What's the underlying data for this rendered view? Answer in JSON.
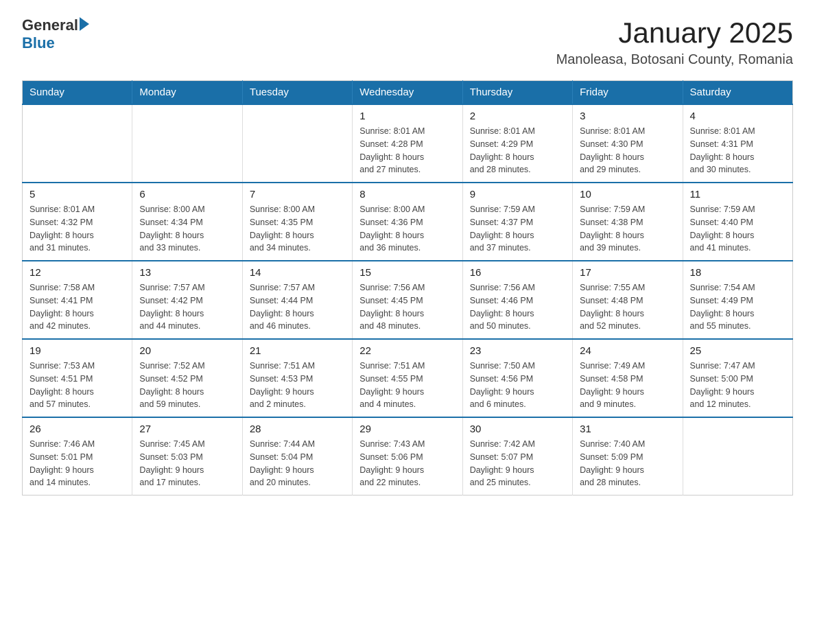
{
  "header": {
    "logo": {
      "text_general": "General",
      "text_blue": "Blue"
    },
    "month_year": "January 2025",
    "location": "Manoleasa, Botosani County, Romania"
  },
  "days_of_week": [
    "Sunday",
    "Monday",
    "Tuesday",
    "Wednesday",
    "Thursday",
    "Friday",
    "Saturday"
  ],
  "weeks": [
    [
      {
        "day": "",
        "info": ""
      },
      {
        "day": "",
        "info": ""
      },
      {
        "day": "",
        "info": ""
      },
      {
        "day": "1",
        "info": "Sunrise: 8:01 AM\nSunset: 4:28 PM\nDaylight: 8 hours\nand 27 minutes."
      },
      {
        "day": "2",
        "info": "Sunrise: 8:01 AM\nSunset: 4:29 PM\nDaylight: 8 hours\nand 28 minutes."
      },
      {
        "day": "3",
        "info": "Sunrise: 8:01 AM\nSunset: 4:30 PM\nDaylight: 8 hours\nand 29 minutes."
      },
      {
        "day": "4",
        "info": "Sunrise: 8:01 AM\nSunset: 4:31 PM\nDaylight: 8 hours\nand 30 minutes."
      }
    ],
    [
      {
        "day": "5",
        "info": "Sunrise: 8:01 AM\nSunset: 4:32 PM\nDaylight: 8 hours\nand 31 minutes."
      },
      {
        "day": "6",
        "info": "Sunrise: 8:00 AM\nSunset: 4:34 PM\nDaylight: 8 hours\nand 33 minutes."
      },
      {
        "day": "7",
        "info": "Sunrise: 8:00 AM\nSunset: 4:35 PM\nDaylight: 8 hours\nand 34 minutes."
      },
      {
        "day": "8",
        "info": "Sunrise: 8:00 AM\nSunset: 4:36 PM\nDaylight: 8 hours\nand 36 minutes."
      },
      {
        "day": "9",
        "info": "Sunrise: 7:59 AM\nSunset: 4:37 PM\nDaylight: 8 hours\nand 37 minutes."
      },
      {
        "day": "10",
        "info": "Sunrise: 7:59 AM\nSunset: 4:38 PM\nDaylight: 8 hours\nand 39 minutes."
      },
      {
        "day": "11",
        "info": "Sunrise: 7:59 AM\nSunset: 4:40 PM\nDaylight: 8 hours\nand 41 minutes."
      }
    ],
    [
      {
        "day": "12",
        "info": "Sunrise: 7:58 AM\nSunset: 4:41 PM\nDaylight: 8 hours\nand 42 minutes."
      },
      {
        "day": "13",
        "info": "Sunrise: 7:57 AM\nSunset: 4:42 PM\nDaylight: 8 hours\nand 44 minutes."
      },
      {
        "day": "14",
        "info": "Sunrise: 7:57 AM\nSunset: 4:44 PM\nDaylight: 8 hours\nand 46 minutes."
      },
      {
        "day": "15",
        "info": "Sunrise: 7:56 AM\nSunset: 4:45 PM\nDaylight: 8 hours\nand 48 minutes."
      },
      {
        "day": "16",
        "info": "Sunrise: 7:56 AM\nSunset: 4:46 PM\nDaylight: 8 hours\nand 50 minutes."
      },
      {
        "day": "17",
        "info": "Sunrise: 7:55 AM\nSunset: 4:48 PM\nDaylight: 8 hours\nand 52 minutes."
      },
      {
        "day": "18",
        "info": "Sunrise: 7:54 AM\nSunset: 4:49 PM\nDaylight: 8 hours\nand 55 minutes."
      }
    ],
    [
      {
        "day": "19",
        "info": "Sunrise: 7:53 AM\nSunset: 4:51 PM\nDaylight: 8 hours\nand 57 minutes."
      },
      {
        "day": "20",
        "info": "Sunrise: 7:52 AM\nSunset: 4:52 PM\nDaylight: 8 hours\nand 59 minutes."
      },
      {
        "day": "21",
        "info": "Sunrise: 7:51 AM\nSunset: 4:53 PM\nDaylight: 9 hours\nand 2 minutes."
      },
      {
        "day": "22",
        "info": "Sunrise: 7:51 AM\nSunset: 4:55 PM\nDaylight: 9 hours\nand 4 minutes."
      },
      {
        "day": "23",
        "info": "Sunrise: 7:50 AM\nSunset: 4:56 PM\nDaylight: 9 hours\nand 6 minutes."
      },
      {
        "day": "24",
        "info": "Sunrise: 7:49 AM\nSunset: 4:58 PM\nDaylight: 9 hours\nand 9 minutes."
      },
      {
        "day": "25",
        "info": "Sunrise: 7:47 AM\nSunset: 5:00 PM\nDaylight: 9 hours\nand 12 minutes."
      }
    ],
    [
      {
        "day": "26",
        "info": "Sunrise: 7:46 AM\nSunset: 5:01 PM\nDaylight: 9 hours\nand 14 minutes."
      },
      {
        "day": "27",
        "info": "Sunrise: 7:45 AM\nSunset: 5:03 PM\nDaylight: 9 hours\nand 17 minutes."
      },
      {
        "day": "28",
        "info": "Sunrise: 7:44 AM\nSunset: 5:04 PM\nDaylight: 9 hours\nand 20 minutes."
      },
      {
        "day": "29",
        "info": "Sunrise: 7:43 AM\nSunset: 5:06 PM\nDaylight: 9 hours\nand 22 minutes."
      },
      {
        "day": "30",
        "info": "Sunrise: 7:42 AM\nSunset: 5:07 PM\nDaylight: 9 hours\nand 25 minutes."
      },
      {
        "day": "31",
        "info": "Sunrise: 7:40 AM\nSunset: 5:09 PM\nDaylight: 9 hours\nand 28 minutes."
      },
      {
        "day": "",
        "info": ""
      }
    ]
  ]
}
